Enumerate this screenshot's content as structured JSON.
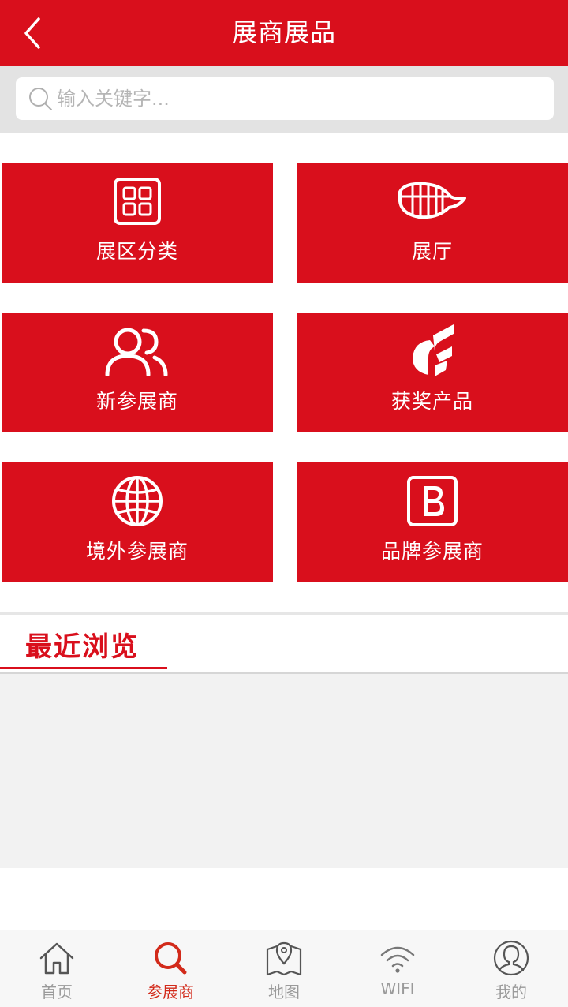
{
  "header": {
    "title": "展商展品"
  },
  "search": {
    "placeholder": "输入关键字..."
  },
  "tiles": [
    {
      "label": "展区分类",
      "icon": "grid-icon"
    },
    {
      "label": "展厅",
      "icon": "stadium-icon"
    },
    {
      "label": "新参展商",
      "icon": "users-icon"
    },
    {
      "label": "获奖产品",
      "icon": "award-logo-icon"
    },
    {
      "label": "境外参展商",
      "icon": "globe-icon"
    },
    {
      "label": "品牌参展商",
      "icon": "brand-b-icon"
    }
  ],
  "recent": {
    "title": "最近浏览"
  },
  "tabbar": {
    "items": [
      {
        "label": "首页",
        "icon": "home-icon",
        "active": false
      },
      {
        "label": "参展商",
        "icon": "search-icon",
        "active": true
      },
      {
        "label": "地图",
        "icon": "map-icon",
        "active": false
      },
      {
        "label": "WIFI",
        "icon": "wifi-icon",
        "active": false
      },
      {
        "label": "我的",
        "icon": "profile-icon",
        "active": false
      }
    ]
  },
  "colors": {
    "brand_red": "#d90f1c",
    "tab_active": "#d22a1a",
    "tab_inactive": "#9a9a9a",
    "search_band": "#e3e3e3",
    "recent_panel": "#f2f2f2"
  }
}
